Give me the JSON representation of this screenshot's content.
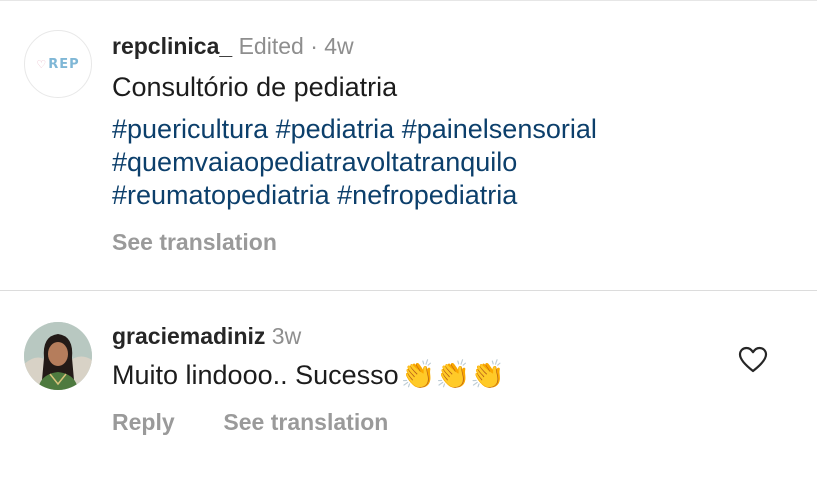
{
  "caption": {
    "avatar_logo_text": "REP",
    "username": "repclinica_",
    "edited_label": "Edited",
    "separator": "·",
    "age": "4w",
    "text": "Consultório de pediatria",
    "hashtags": [
      "#puericultura",
      "#pediatria",
      "#painelsensorial",
      "#quemvaiaopediatravoltatranquilo",
      "#reumatopediatria",
      "#nefropediatria"
    ],
    "see_translation_label": "See translation"
  },
  "reply": {
    "username": "graciemadiniz",
    "age": "3w",
    "text": "Muito lindooo.. Sucesso",
    "emoji": "👏👏👏",
    "reply_label": "Reply",
    "see_translation_label": "See translation",
    "like_icon": "heart-outline-icon"
  },
  "colors": {
    "hashtag": "#0c3f6b",
    "muted": "#8e8e8e",
    "username": "#262626"
  }
}
